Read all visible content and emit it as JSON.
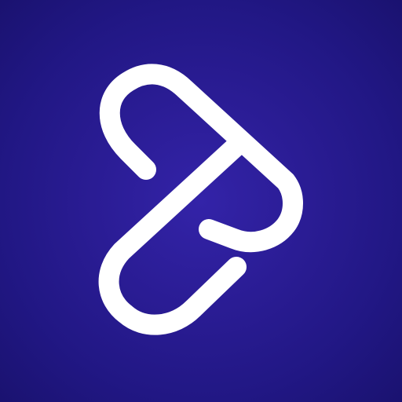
{
  "app_icon": {
    "name": "app-icon",
    "logo": {
      "name": "linked-pill-logo",
      "icon": "linked-pill-logo-icon",
      "stroke_color": "#ffffff"
    },
    "background": {
      "center_color": "#3323a8",
      "edge_color": "#1a1270"
    }
  }
}
